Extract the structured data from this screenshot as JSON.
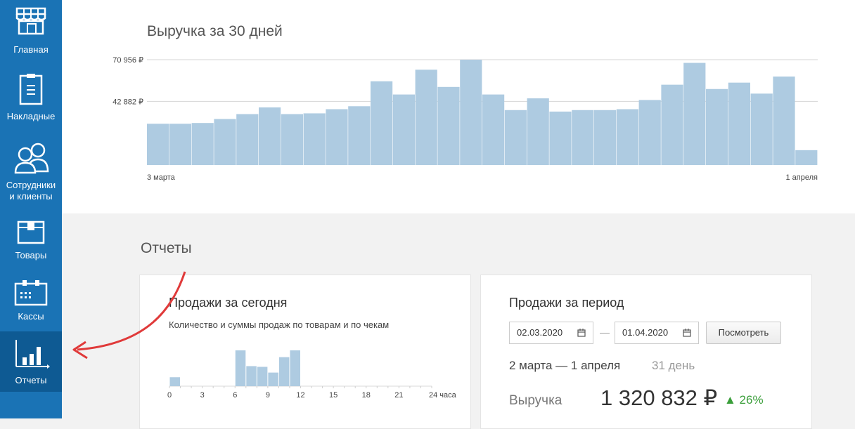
{
  "sidebar": {
    "items": [
      {
        "label": "Главная",
        "icon": "store-icon"
      },
      {
        "label": "Накладные",
        "icon": "clipboard-icon"
      },
      {
        "label": "Сотрудники\nи клиенты",
        "label_line1": "Сотрудники",
        "label_line2": "и клиенты",
        "icon": "people-icon"
      },
      {
        "label": "Товары",
        "icon": "box-icon"
      },
      {
        "label": "Кассы",
        "icon": "register-icon"
      },
      {
        "label": "Отчеты",
        "icon": "bar-chart-icon",
        "active": true
      }
    ],
    "colors": {
      "bg": "#1a73b5",
      "active_bg": "#0e5a93"
    }
  },
  "revenue": {
    "title": "Выручка за 30 дней",
    "tick_high": "70 956 ₽",
    "tick_mid": "42 882 ₽",
    "x_start": "3 марта",
    "x_end": "1 апреля"
  },
  "reports": {
    "title": "Отчеты",
    "today": {
      "title": "Продажи за сегодня",
      "subtitle": "Количество и суммы продаж по товарам и по чекам",
      "x_unit": "24 часа"
    },
    "period": {
      "title": "Продажи за период",
      "date_from": "02.03.2020",
      "date_to": "01.04.2020",
      "dash": "—",
      "button": "Посмотреть",
      "range": "2 марта — 1 апреля",
      "days": "31 день",
      "revenue_label": "Выручка",
      "revenue_value": "1 320 832 ₽",
      "change": "▲ 26%"
    }
  },
  "chart_data": [
    {
      "type": "bar",
      "ylim": [
        0,
        70956
      ],
      "yticks": [
        42882,
        70956
      ],
      "x": [
        "2020-03-03",
        "2020-03-04",
        "2020-03-05",
        "2020-03-06",
        "2020-03-07",
        "2020-03-08",
        "2020-03-09",
        "2020-03-10",
        "2020-03-11",
        "2020-03-12",
        "2020-03-13",
        "2020-03-14",
        "2020-03-15",
        "2020-03-16",
        "2020-03-17",
        "2020-03-18",
        "2020-03-19",
        "2020-03-20",
        "2020-03-21",
        "2020-03-22",
        "2020-03-23",
        "2020-03-24",
        "2020-03-25",
        "2020-03-26",
        "2020-03-27",
        "2020-03-28",
        "2020-03-29",
        "2020-03-30",
        "2020-03-31",
        "2020-04-01"
      ],
      "values": [
        27800,
        27800,
        28300,
        31000,
        34300,
        38800,
        34300,
        34800,
        37600,
        39600,
        56400,
        47500,
        64200,
        52600,
        70956,
        47500,
        37000,
        44900,
        36000,
        37000,
        37000,
        37600,
        43800,
        54100,
        68800,
        51200,
        55500,
        48100,
        59600,
        10000
      ],
      "grid": true,
      "color": "#aecbe1"
    },
    {
      "type": "bar",
      "x": [
        0,
        1,
        2,
        3,
        4,
        5,
        6,
        7,
        8,
        9,
        10,
        11,
        12,
        13,
        14,
        15,
        16,
        17,
        18,
        19,
        20,
        21,
        22,
        23
      ],
      "xticks": [
        0,
        3,
        6,
        9,
        12,
        15,
        18,
        21,
        24
      ],
      "values": [
        0.25,
        0,
        0,
        0,
        0,
        0,
        1.0,
        0.56,
        0.54,
        0.38,
        0.81,
        1.0,
        0,
        0,
        0,
        0,
        0,
        0,
        0,
        0,
        0,
        0,
        0,
        0
      ],
      "color": "#aecbe1"
    }
  ]
}
